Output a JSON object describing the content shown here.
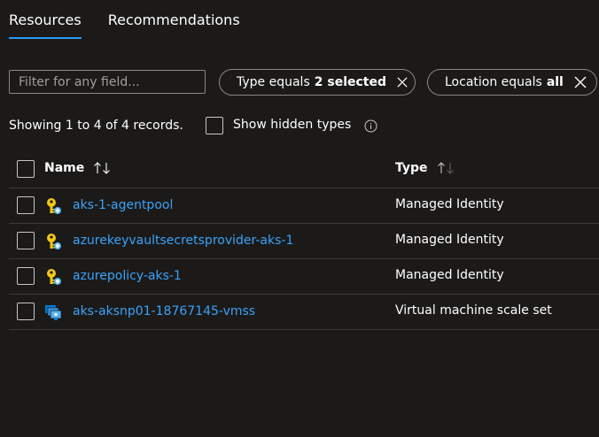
{
  "tabs": [
    {
      "label": "Resources",
      "active": true
    },
    {
      "label": "Recommendations",
      "active": false
    }
  ],
  "filter": {
    "placeholder": "Filter for any field...",
    "value": ""
  },
  "pills": {
    "type": {
      "prefix": "Type equals",
      "value": "2 selected",
      "close_icon": "close-icon"
    },
    "location": {
      "prefix": "Location equals",
      "value": "all",
      "close_icon": "close-icon"
    }
  },
  "records_text": "Showing 1 to 4 of 4 records.",
  "show_hidden_label": "Show hidden types",
  "columns": {
    "name": "Name",
    "type": "Type"
  },
  "rows": [
    {
      "name": "aks-1-agentpool",
      "type": "Managed Identity",
      "icon": "managed-identity-icon"
    },
    {
      "name": "azurekeyvaultsecretsprovider-aks-1",
      "type": "Managed Identity",
      "icon": "managed-identity-icon"
    },
    {
      "name": "azurepolicy-aks-1",
      "type": "Managed Identity",
      "icon": "managed-identity-icon"
    },
    {
      "name": "aks-aksnp01-18767145-vmss",
      "type": "Virtual machine scale set",
      "icon": "vmss-icon"
    }
  ],
  "colors": {
    "background": "#1b1a19",
    "accent": "#2899f5",
    "link": "#3ba2f7",
    "key_yellow": "#f2c811",
    "vmss_blue": "#0078d4"
  }
}
